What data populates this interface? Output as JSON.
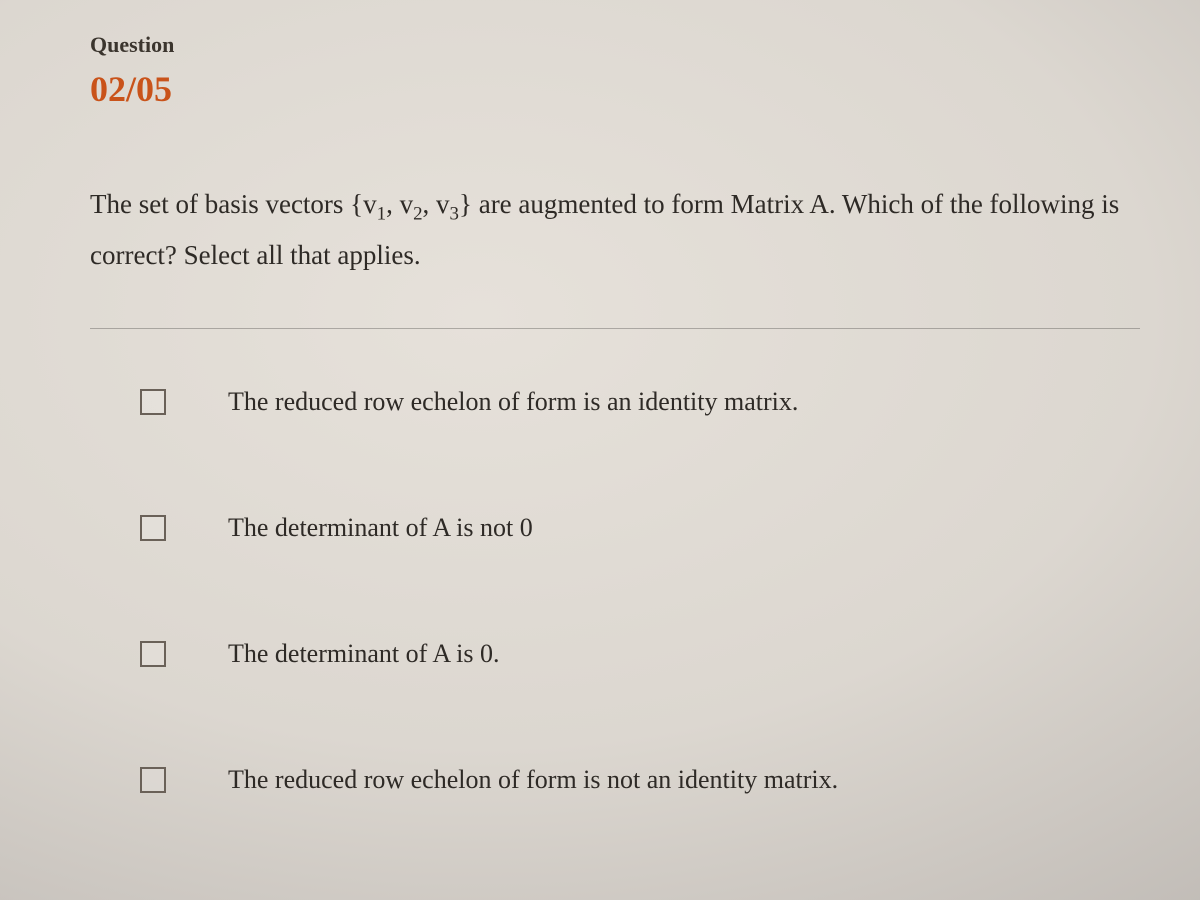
{
  "header": {
    "label": "Question",
    "counter": "02/05"
  },
  "prompt": {
    "pre": "The set of basis vectors {v",
    "s1": "1",
    "mid1": ", v",
    "s2": "2",
    "mid2": ", v",
    "s3": "3",
    "post": "} are augmented to form Matrix A. Which of the following is correct? Select all that applies."
  },
  "options": [
    {
      "text": "The reduced row echelon of form is an identity matrix."
    },
    {
      "text": "The determinant of A is not 0"
    },
    {
      "text": "The determinant of A is 0."
    },
    {
      "text": "The reduced row echelon of form is not an identity matrix."
    }
  ]
}
